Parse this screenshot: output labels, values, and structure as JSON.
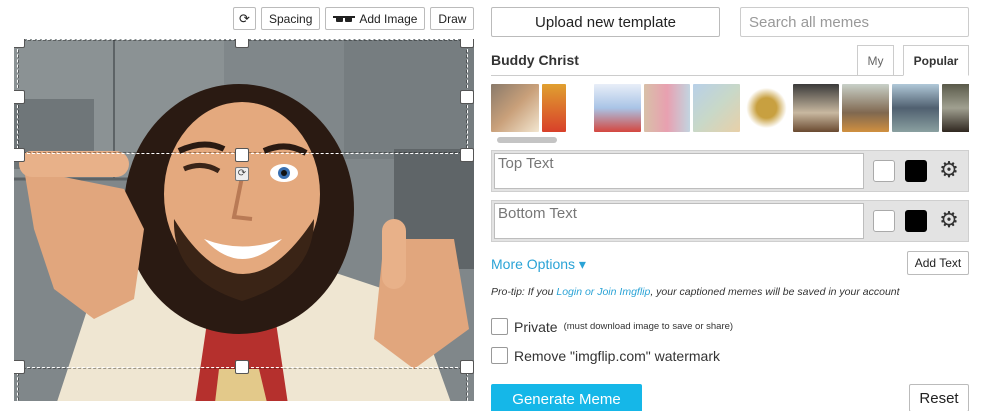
{
  "toolbar": {
    "rotate_icon": "rotate-icon",
    "spacing_label": "Spacing",
    "add_image_label": "Add Image",
    "draw_label": "Draw"
  },
  "canvas": {
    "image_subject": "meme-image",
    "handle_icon": "resize-handle"
  },
  "panel": {
    "upload_label": "Upload new template",
    "search_placeholder": "Search all memes",
    "template_name": "Buddy Christ",
    "tabs": [
      {
        "label": "My",
        "active": false
      },
      {
        "label": "Popular",
        "active": true
      }
    ],
    "text_boxes": [
      {
        "placeholder": "Top Text",
        "value": ""
      },
      {
        "placeholder": "Bottom Text",
        "value": ""
      }
    ],
    "more_options_label": "More Options ▾",
    "add_text_label": "Add Text",
    "protip_prefix": "Pro-tip: If you ",
    "protip_link": "Login or Join Imgflip",
    "protip_suffix": ", your captioned memes will be saved in your account",
    "private_label": "Private",
    "private_note": "(must download image to save or share)",
    "watermark_label": "Remove \"imgflip.com\" watermark",
    "generate_label": "Generate Meme",
    "reset_label": "Reset"
  },
  "colors": {
    "accent": "#15b7e8",
    "link": "#2aa3d6"
  }
}
